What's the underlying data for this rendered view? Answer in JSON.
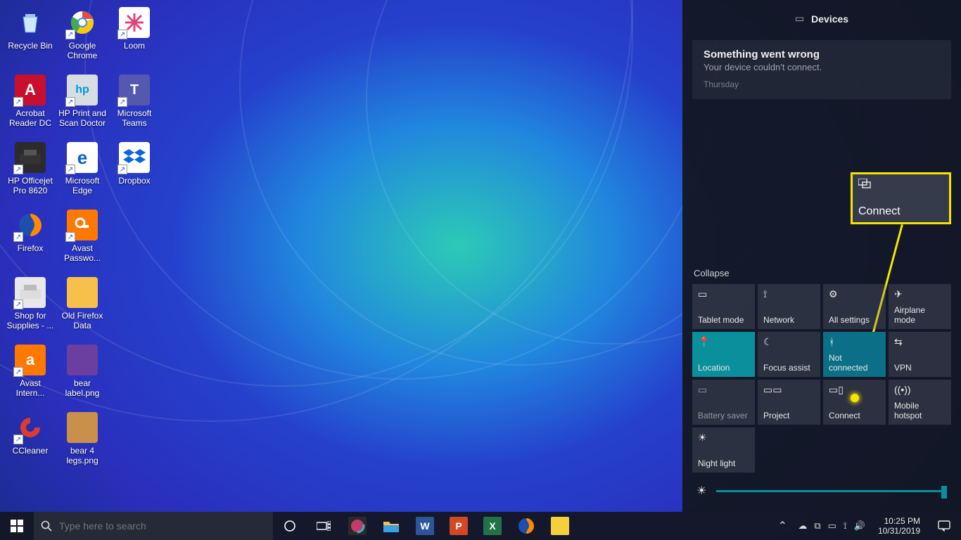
{
  "desktop_icons": {
    "col1": [
      "Recycle Bin",
      "Acrobat Reader DC",
      "HP Officejet Pro 8620",
      "Firefox",
      "Shop for Supplies - ...",
      "Avast Intern...",
      "CCleaner"
    ],
    "col2": [
      "Google Chrome",
      "HP Print and Scan Doctor",
      "Microsoft Edge",
      "Avast Passwo...",
      "Old Firefox Data",
      "bear label.png",
      "bear 4 legs.png"
    ],
    "col3": [
      "Loom",
      "Microsoft Teams",
      "Dropbox"
    ]
  },
  "action_center": {
    "header": "Devices",
    "notification": {
      "title": "Something went wrong",
      "message": "Your device couldn't connect.",
      "when": "Thursday"
    },
    "collapse": "Collapse",
    "callout_label": "Connect",
    "tiles": [
      {
        "label": "Tablet mode",
        "icon": "tablet"
      },
      {
        "label": "Network",
        "icon": "wifi"
      },
      {
        "label": "All settings",
        "icon": "gear"
      },
      {
        "label": "Airplane mode",
        "icon": "airplane"
      },
      {
        "label": "Location",
        "icon": "location",
        "state": "on"
      },
      {
        "label": "Focus assist",
        "icon": "moon"
      },
      {
        "label": "Not connected",
        "icon": "bluetooth",
        "state": "on2"
      },
      {
        "label": "VPN",
        "icon": "vpn"
      },
      {
        "label": "Battery saver",
        "icon": "battery",
        "dim": true
      },
      {
        "label": "Project",
        "icon": "project"
      },
      {
        "label": "Connect",
        "icon": "connect",
        "highlight": true
      },
      {
        "label": "Mobile hotspot",
        "icon": "hotspot"
      },
      {
        "label": "Night light",
        "icon": "nightlight"
      }
    ]
  },
  "taskbar": {
    "search_placeholder": "Type here to search",
    "apps": [
      "cortana",
      "taskview",
      "snip",
      "explorer",
      "word",
      "powerpoint",
      "excel",
      "firefox",
      "sticky"
    ],
    "clock": {
      "time": "10:25 PM",
      "date": "10/31/2019"
    }
  }
}
